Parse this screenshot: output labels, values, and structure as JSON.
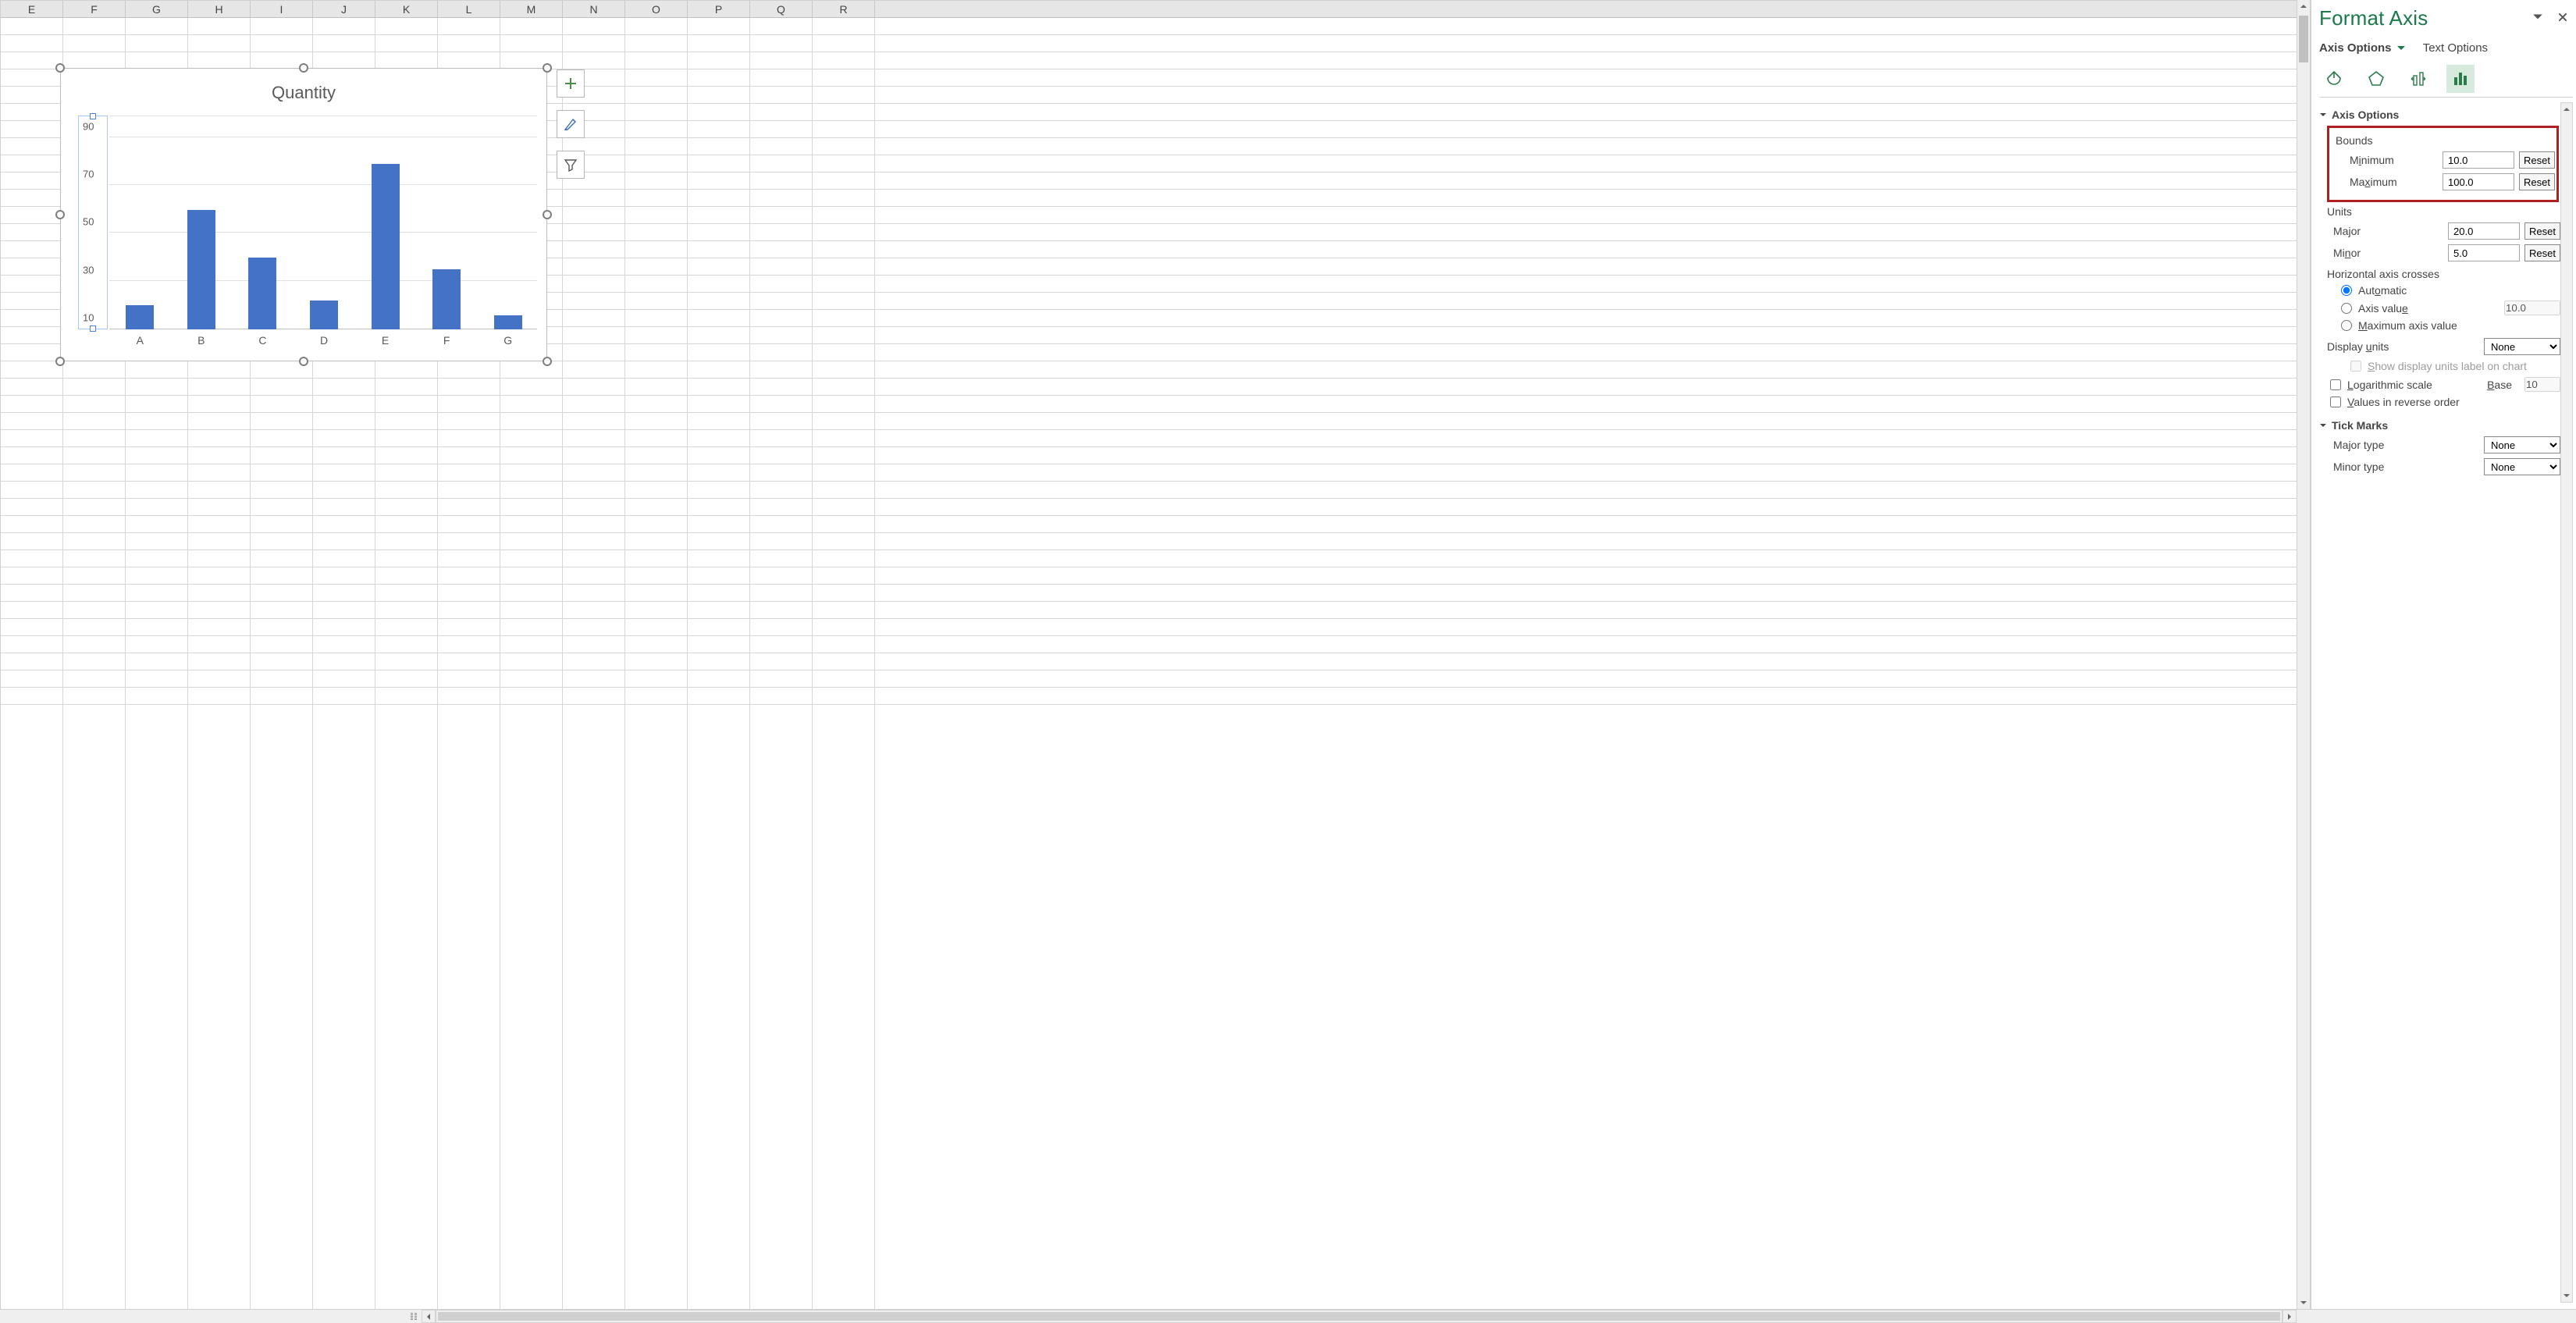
{
  "columns": [
    "E",
    "F",
    "G",
    "H",
    "I",
    "J",
    "K",
    "L",
    "M",
    "N",
    "O",
    "P",
    "Q",
    "R"
  ],
  "chart_data": {
    "type": "bar",
    "title": "Quantity",
    "categories": [
      "A",
      "B",
      "C",
      "D",
      "E",
      "F",
      "G"
    ],
    "values": [
      20,
      60,
      40,
      22,
      79,
      35,
      16
    ],
    "ylabel": "",
    "xlabel": "",
    "ylim": [
      10,
      100
    ],
    "yticks": [
      10,
      30,
      50,
      70,
      90
    ]
  },
  "pane": {
    "title": "Format Axis",
    "tab_axis_options": "Axis Options",
    "tab_text_options": "Text Options",
    "section_axis_options": "Axis Options",
    "bounds_label": "Bounds",
    "bounds_min_label": "Minimum",
    "bounds_min_value": "10.0",
    "bounds_max_label": "Maximum",
    "bounds_max_value": "100.0",
    "units_label": "Units",
    "units_major_label": "Major",
    "units_major_value": "20.0",
    "units_minor_label": "Minor",
    "units_minor_value": "5.0",
    "reset_label": "Reset",
    "hcross_label": "Horizontal axis crosses",
    "hcross_auto": "Automatic",
    "hcross_axisvalue": "Axis value",
    "hcross_axisvalue_value": "10.0",
    "hcross_max": "Maximum axis value",
    "display_units_label": "Display units",
    "display_units_value": "None",
    "show_display_units_label": "Show display units label on chart",
    "log_scale_label": "Logarithmic scale",
    "log_base_label": "Base",
    "log_base_value": "10",
    "reverse_label": "Values in reverse order",
    "section_tick_marks": "Tick Marks",
    "tick_major_label": "Major type",
    "tick_major_value": "None",
    "tick_minor_label": "Minor type",
    "tick_minor_value": "None"
  }
}
